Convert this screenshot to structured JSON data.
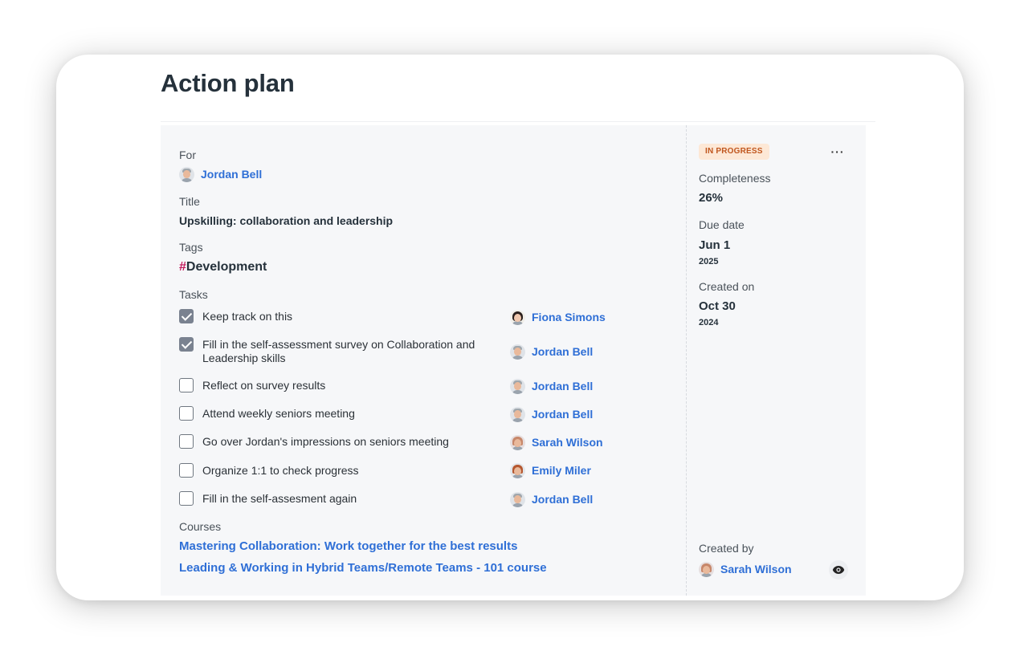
{
  "page": {
    "title": "Action plan"
  },
  "details": {
    "for_label": "For",
    "for_person": "Jordan Bell",
    "title_label": "Title",
    "title_value": "Upskilling: collaboration and leadership",
    "tags_label": "Tags",
    "tag_hash": "#",
    "tag_value": "Development",
    "tasks_label": "Tasks",
    "tasks": [
      {
        "text": "Keep track on this",
        "done": true,
        "assignee": "Fiona Simons",
        "avatar": "dark"
      },
      {
        "text": "Fill in the self-assessment survey on Collaboration and Leadership skills",
        "done": true,
        "assignee": "Jordan Bell",
        "avatar": "male"
      },
      {
        "text": "Reflect on survey results",
        "done": false,
        "assignee": "Jordan Bell",
        "avatar": "male"
      },
      {
        "text": "Attend weekly seniors meeting",
        "done": false,
        "assignee": "Jordan Bell",
        "avatar": "male"
      },
      {
        "text": "Go over Jordan's impressions on seniors meeting",
        "done": false,
        "assignee": "Sarah Wilson",
        "avatar": "female"
      },
      {
        "text": "Organize 1:1 to check progress",
        "done": false,
        "assignee": "Emily Miler",
        "avatar": "red"
      },
      {
        "text": "Fill in the self-assesment again",
        "done": false,
        "assignee": "Jordan Bell",
        "avatar": "male"
      }
    ],
    "courses_label": "Courses",
    "courses": [
      "Mastering Collaboration: Work together for the best results",
      "Leading & Working in Hybrid Teams/Remote Teams - 101 course"
    ]
  },
  "sidebar": {
    "status": "IN PROGRESS",
    "more_icon": "more-horizontal-icon",
    "more_label": "···",
    "completeness_label": "Completeness",
    "completeness_value": "26%",
    "due_label": "Due date",
    "due_day": "Jun 1",
    "due_year": "2025",
    "created_label": "Created on",
    "created_day": "Oct 30",
    "created_year": "2024",
    "created_by_label": "Created by",
    "created_by": "Sarah Wilson",
    "view_icon": "eye-icon"
  },
  "colors": {
    "link": "#2f6fd6",
    "status_bg": "#fde8d6",
    "status_text": "#c0561e",
    "tag_hash": "#c2185b",
    "panel_bg": "#f6f7f9"
  }
}
